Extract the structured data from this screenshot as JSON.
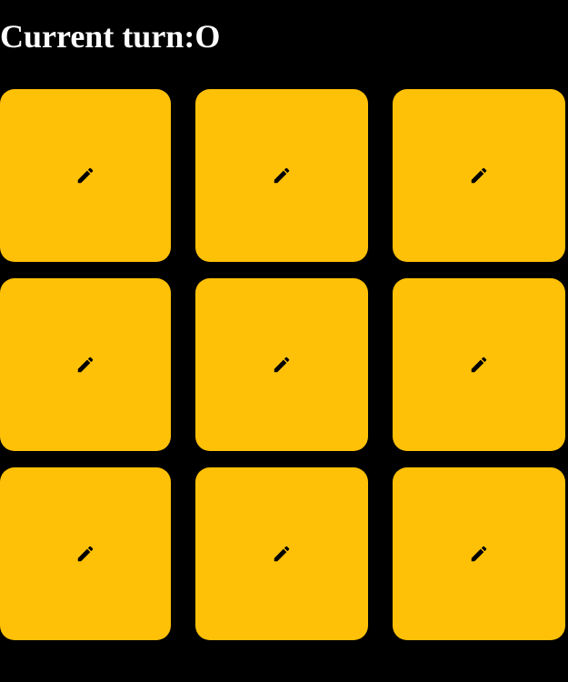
{
  "status": {
    "label": "Current turn:",
    "player": "O"
  },
  "board": {
    "cells": [
      {
        "row": 1,
        "col": 1,
        "value": "",
        "icon": "pencil-icon"
      },
      {
        "row": 1,
        "col": 2,
        "value": "",
        "icon": "pencil-icon"
      },
      {
        "row": 1,
        "col": 3,
        "value": "",
        "icon": "pencil-icon"
      },
      {
        "row": 2,
        "col": 1,
        "value": "",
        "icon": "pencil-icon"
      },
      {
        "row": 2,
        "col": 2,
        "value": "",
        "icon": "pencil-icon"
      },
      {
        "row": 2,
        "col": 3,
        "value": "",
        "icon": "pencil-icon"
      },
      {
        "row": 3,
        "col": 1,
        "value": "",
        "icon": "pencil-icon"
      },
      {
        "row": 3,
        "col": 2,
        "value": "",
        "icon": "pencil-icon"
      },
      {
        "row": 3,
        "col": 3,
        "value": "",
        "icon": "pencil-icon"
      }
    ]
  },
  "colors": {
    "background": "#000000",
    "cell": "#ffc107",
    "text": "#ffffff",
    "icon": "#000000"
  }
}
